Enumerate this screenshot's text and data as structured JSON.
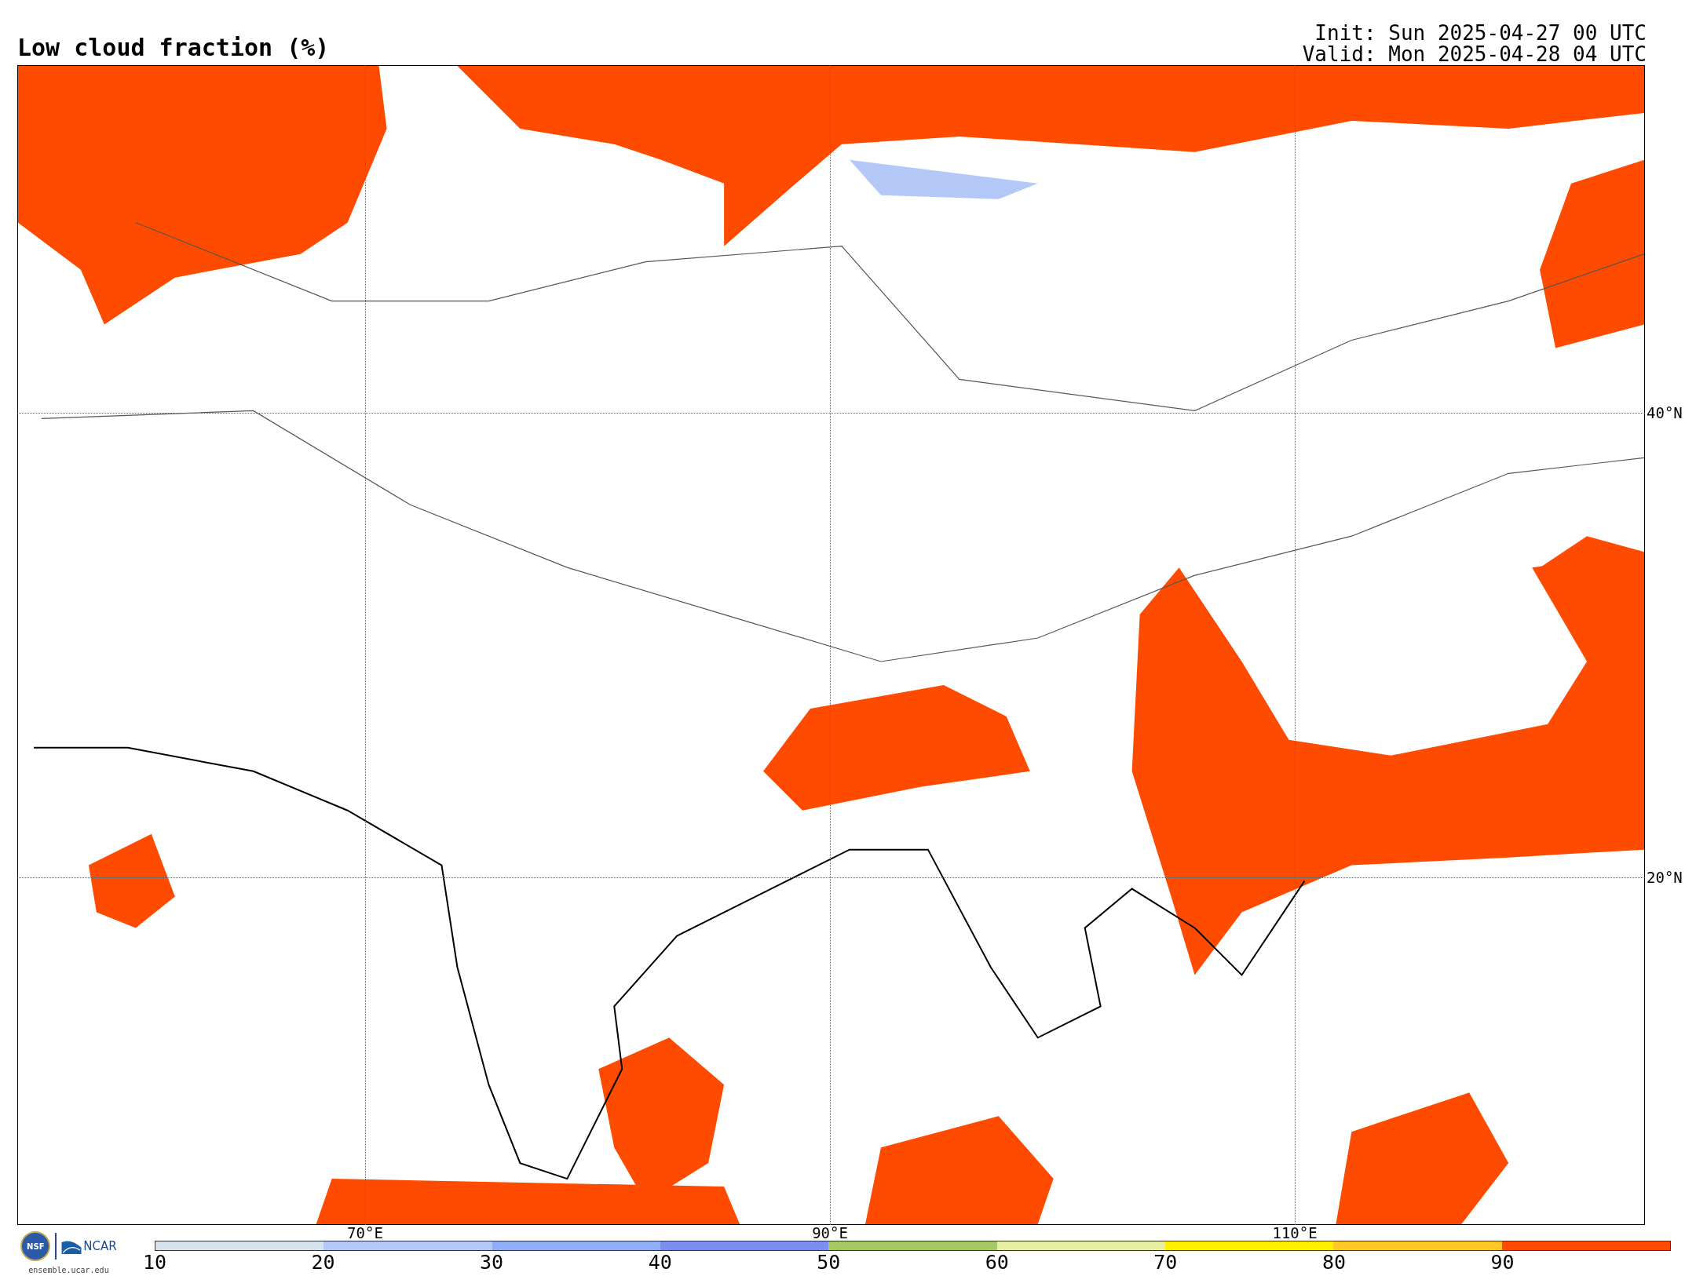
{
  "title": "Low cloud fraction (%)",
  "init": "Init: Sun 2025-04-27 00 UTC",
  "valid": "Valid: Mon 2025-04-28 04 UTC",
  "map": {
    "latitudes": [
      "40°N",
      "20°N"
    ],
    "longitudes": [
      "70°E",
      "90°E",
      "110°E"
    ]
  },
  "logos": {
    "nsf": "NSF",
    "ncar": "NCAR",
    "site": "ensemble.ucar.edu"
  },
  "colorbar": [
    {
      "label": "10",
      "color": "#d6e2ec"
    },
    {
      "label": "20",
      "color": "#b4c8f8"
    },
    {
      "label": "30",
      "color": "#8eaef8"
    },
    {
      "label": "40",
      "color": "#7c8ef0"
    },
    {
      "label": "50",
      "color": "#a4c864"
    },
    {
      "label": "60",
      "color": "#e6f0a0"
    },
    {
      "label": "70",
      "color": "#fff000"
    },
    {
      "label": "80",
      "color": "#ffc828"
    },
    {
      "label": "90",
      "color": "#ff4b00"
    }
  ]
}
